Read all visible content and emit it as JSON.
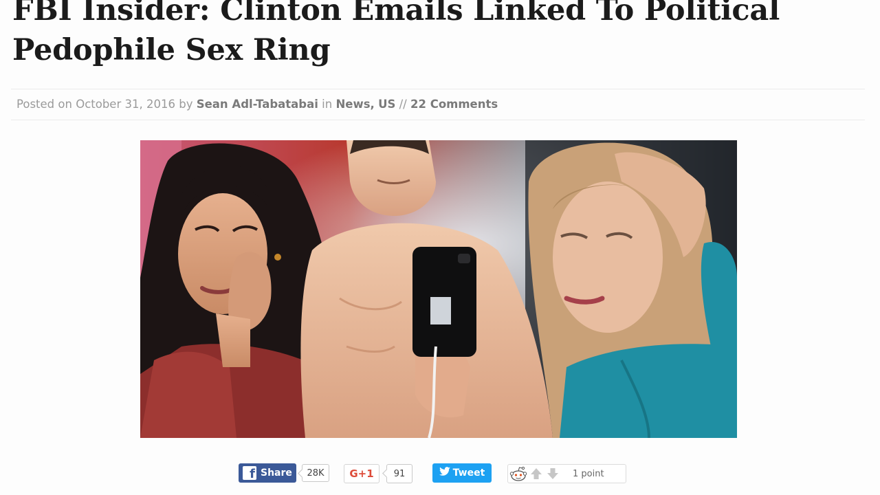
{
  "article": {
    "title_line1": "FBI Insider: Clinton Emails Linked To Political",
    "title_line2": "Pedophile Sex Ring",
    "meta": {
      "posted_prefix": "Posted on",
      "date": "October 31, 2016",
      "by": "by",
      "author": "Sean Adl-Tabatabai",
      "in": "in",
      "category_news": "News",
      "separator_comma": ",",
      "category_us": "US",
      "comments_separator": "//",
      "comments": "22 Comments"
    }
  },
  "share_bar": {
    "facebook": {
      "label": "Share",
      "count": "28K",
      "icon": "facebook-icon",
      "color": "#3b5998"
    },
    "google_plus": {
      "label": "G+1",
      "count": "91",
      "color": "#dd4b39"
    },
    "twitter": {
      "label": "Tweet",
      "icon": "twitter-bird-icon",
      "color": "#1da1f2"
    },
    "reddit": {
      "points": "1 point",
      "icon": "reddit-alien-icon"
    }
  }
}
